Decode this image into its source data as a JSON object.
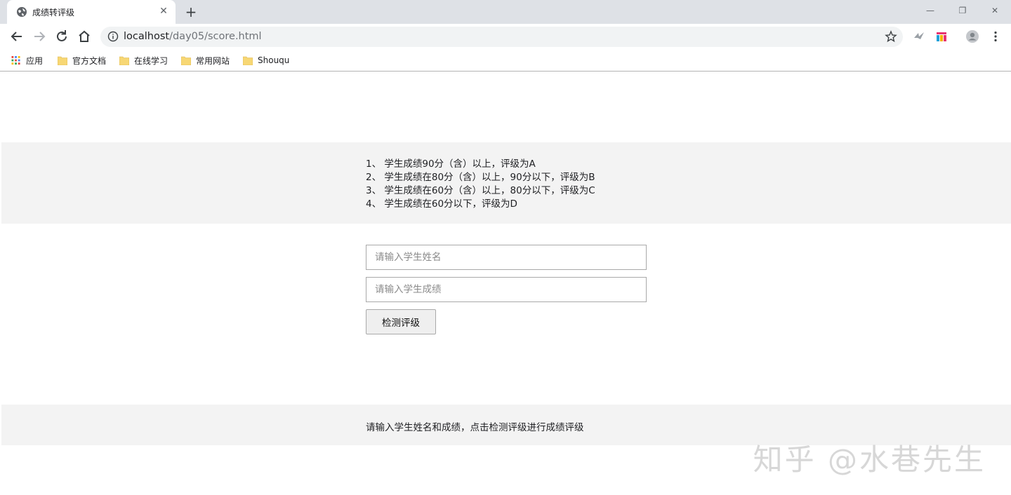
{
  "browser": {
    "tab": {
      "title": "成绩转评级",
      "close": "✕"
    },
    "new_tab": "+",
    "window_controls": {
      "minimize": "—",
      "restore": "❐",
      "close": "✕"
    },
    "address": {
      "host": "localhost",
      "path": "/day05/score.html"
    },
    "bookmarks": [
      {
        "label": "应用",
        "icon": "apps-grid-icon"
      },
      {
        "label": "官方文档",
        "icon": "folder-icon"
      },
      {
        "label": "在线学习",
        "icon": "folder-icon"
      },
      {
        "label": "常用网站",
        "icon": "folder-icon"
      },
      {
        "label": "Shouqu",
        "icon": "folder-icon"
      }
    ]
  },
  "page": {
    "rules": [
      "1、 学生成绩90分（含）以上，评级为A",
      "2、 学生成绩在80分（含）以上，90分以下，评级为B",
      "3、 学生成绩在60分（含）以上，80分以下，评级为C",
      "4、 学生成绩在60分以下，评级为D"
    ],
    "form": {
      "name_placeholder": "请输入学生姓名",
      "score_placeholder": "请输入学生成绩",
      "submit_label": "检测评级"
    },
    "result_text": "请输入学生姓名和成绩，点击检测评级进行成绩评级"
  },
  "watermark": "知乎 @水巷先生",
  "colors": {
    "tabstrip": "#dee1e6",
    "omnibox": "#f1f3f4",
    "band": "#f3f3f3",
    "folder": "#f7d774"
  }
}
